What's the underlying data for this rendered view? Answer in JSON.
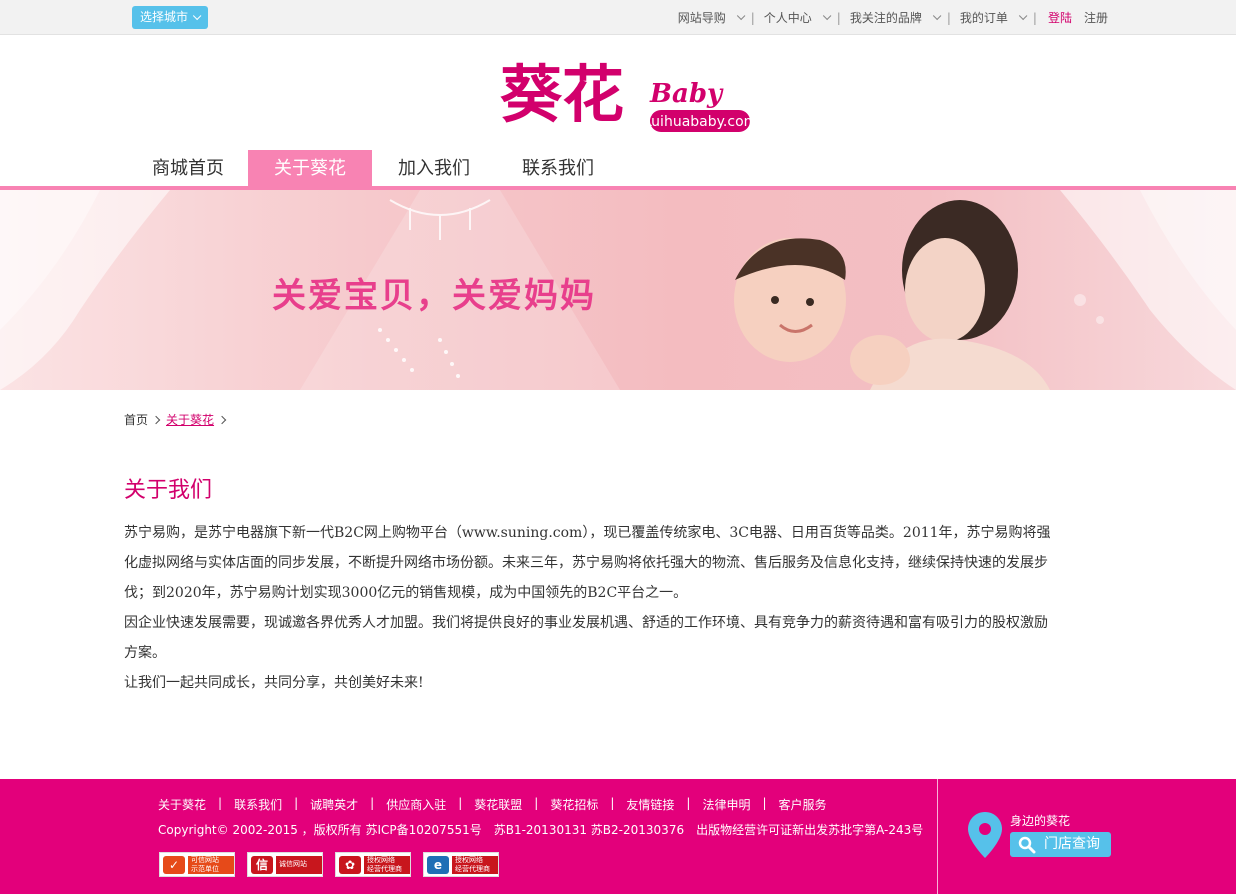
{
  "topbar": {
    "city_button": "选择城市",
    "nav": [
      {
        "label": "网站导购"
      },
      {
        "label": "个人中心"
      },
      {
        "label": "我关注的品牌"
      },
      {
        "label": "我的订单"
      }
    ],
    "login": "登陆",
    "register": "注册"
  },
  "logo": {
    "text_main": "葵花",
    "text_sub": "Baby",
    "domain": "Kuihuababy.com"
  },
  "mainnav": {
    "tabs": [
      {
        "label": "商城首页"
      },
      {
        "label": "关于葵花"
      },
      {
        "label": "加入我们"
      },
      {
        "label": "联系我们"
      }
    ],
    "active_index": 1
  },
  "banner": {
    "slogan": "关爱宝贝，关爱妈妈"
  },
  "breadcrumb": {
    "home": "首页",
    "current": "关于葵花"
  },
  "article": {
    "title": "关于我们",
    "paragraphs": [
      "苏宁易购，是苏宁电器旗下新一代B2C网上购物平台（www.suning.com），现已覆盖传统家电、3C电器、日用百货等品类。2011年，苏宁易购将强化虚拟网络与实体店面的同步发展，不断提升网络市场份额。未来三年，苏宁易购将依托强大的物流、售后服务及信息化支持，继续保持快速的发展步伐；到2020年，苏宁易购计划实现3000亿元的销售规模，成为中国领先的B2C平台之一。",
      "因企业快速发展需要，现诚邀各界优秀人才加盟。我们将提供良好的事业发展机遇、舒适的工作环境、具有竞争力的薪资待遇和富有吸引力的股权激励方案。",
      "让我们一起共同成长，共同分享，共创美好未来!"
    ]
  },
  "footer": {
    "links": [
      {
        "label": "关于葵花"
      },
      {
        "label": "联系我们"
      },
      {
        "label": "诚聘英才"
      },
      {
        "label": "供应商入驻"
      },
      {
        "label": "葵花联盟"
      },
      {
        "label": "葵花招标"
      },
      {
        "label": "友情链接"
      },
      {
        "label": "法律申明"
      },
      {
        "label": "客户服务"
      }
    ],
    "copyright": "Copyright© 2002-2015 ，版权所有 苏ICP备10207551号　苏B1-20130131 苏B2-20130376　出版物经营许可证新出发苏批字第A-243号",
    "badges": [
      {
        "line1": "可信网站",
        "line2": "示范单位",
        "icon": "kexin-icon",
        "color": "#e64a19"
      },
      {
        "line1": "诚信网站",
        "line2": "",
        "icon": "xin-icon",
        "color": "#c8161d"
      },
      {
        "line1": "授权网络",
        "line2": "经营代理商",
        "icon": "unicom-icon",
        "color": "#c8161d"
      },
      {
        "line1": "授权网络",
        "line2": "经营代理商",
        "icon": "telecom-icon",
        "color": "#1f6fb5"
      }
    ],
    "nearby_label": "身边的葵花",
    "store_search": "门店查询"
  },
  "colors": {
    "brand_pink": "#e3007b",
    "nav_pink": "#f883b3",
    "accent_blue": "#56c1ea",
    "title_pink": "#d2006c"
  }
}
